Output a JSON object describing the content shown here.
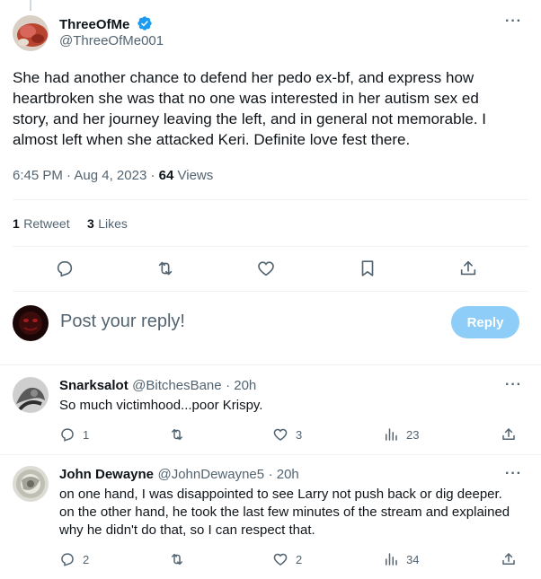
{
  "main_tweet": {
    "author_name": "ThreeOfMe",
    "author_handle": "@ThreeOfMe001",
    "text": "She had another chance to defend her pedo ex-bf, and express how heartbroken she was that no one was interested in her autism sex ed story, and her journey leaving the left, and in general not memorable. I almost left when she attacked Keri. Definite love fest there.",
    "time": "6:45 PM",
    "date": "Aug 4, 2023",
    "views_count": "64",
    "views_label": "Views",
    "retweets_count": "1",
    "retweets_label": "Retweet",
    "likes_count": "3",
    "likes_label": "Likes"
  },
  "reply_box": {
    "placeholder": "Post your reply!",
    "button_label": "Reply"
  },
  "replies": [
    {
      "name": "Snarksalot",
      "handle": "@BitchesBane",
      "time": "· 20h",
      "text": "So much victimhood...poor Krispy.",
      "reply_count": "1",
      "retweet_count": "",
      "like_count": "3",
      "view_count": "23"
    },
    {
      "name": "John Dewayne",
      "handle": "@JohnDewayne5",
      "time": "· 20h",
      "text": "on one hand, I was disappointed to see Larry not push back or dig deeper. on the other hand, he took the last few minutes of the stream and explained why he didn't do that,  so I can respect that.",
      "reply_count": "2",
      "retweet_count": "",
      "like_count": "2",
      "view_count": "34"
    }
  ],
  "colors": {
    "verified": "#1d9bf0",
    "reply_button": "#8ecdf8",
    "secondary_text": "#536471"
  },
  "icons": [
    "more-icon",
    "verified-badge-icon",
    "reply-icon",
    "retweet-icon",
    "like-icon",
    "bookmark-icon",
    "share-icon",
    "views-icon"
  ]
}
